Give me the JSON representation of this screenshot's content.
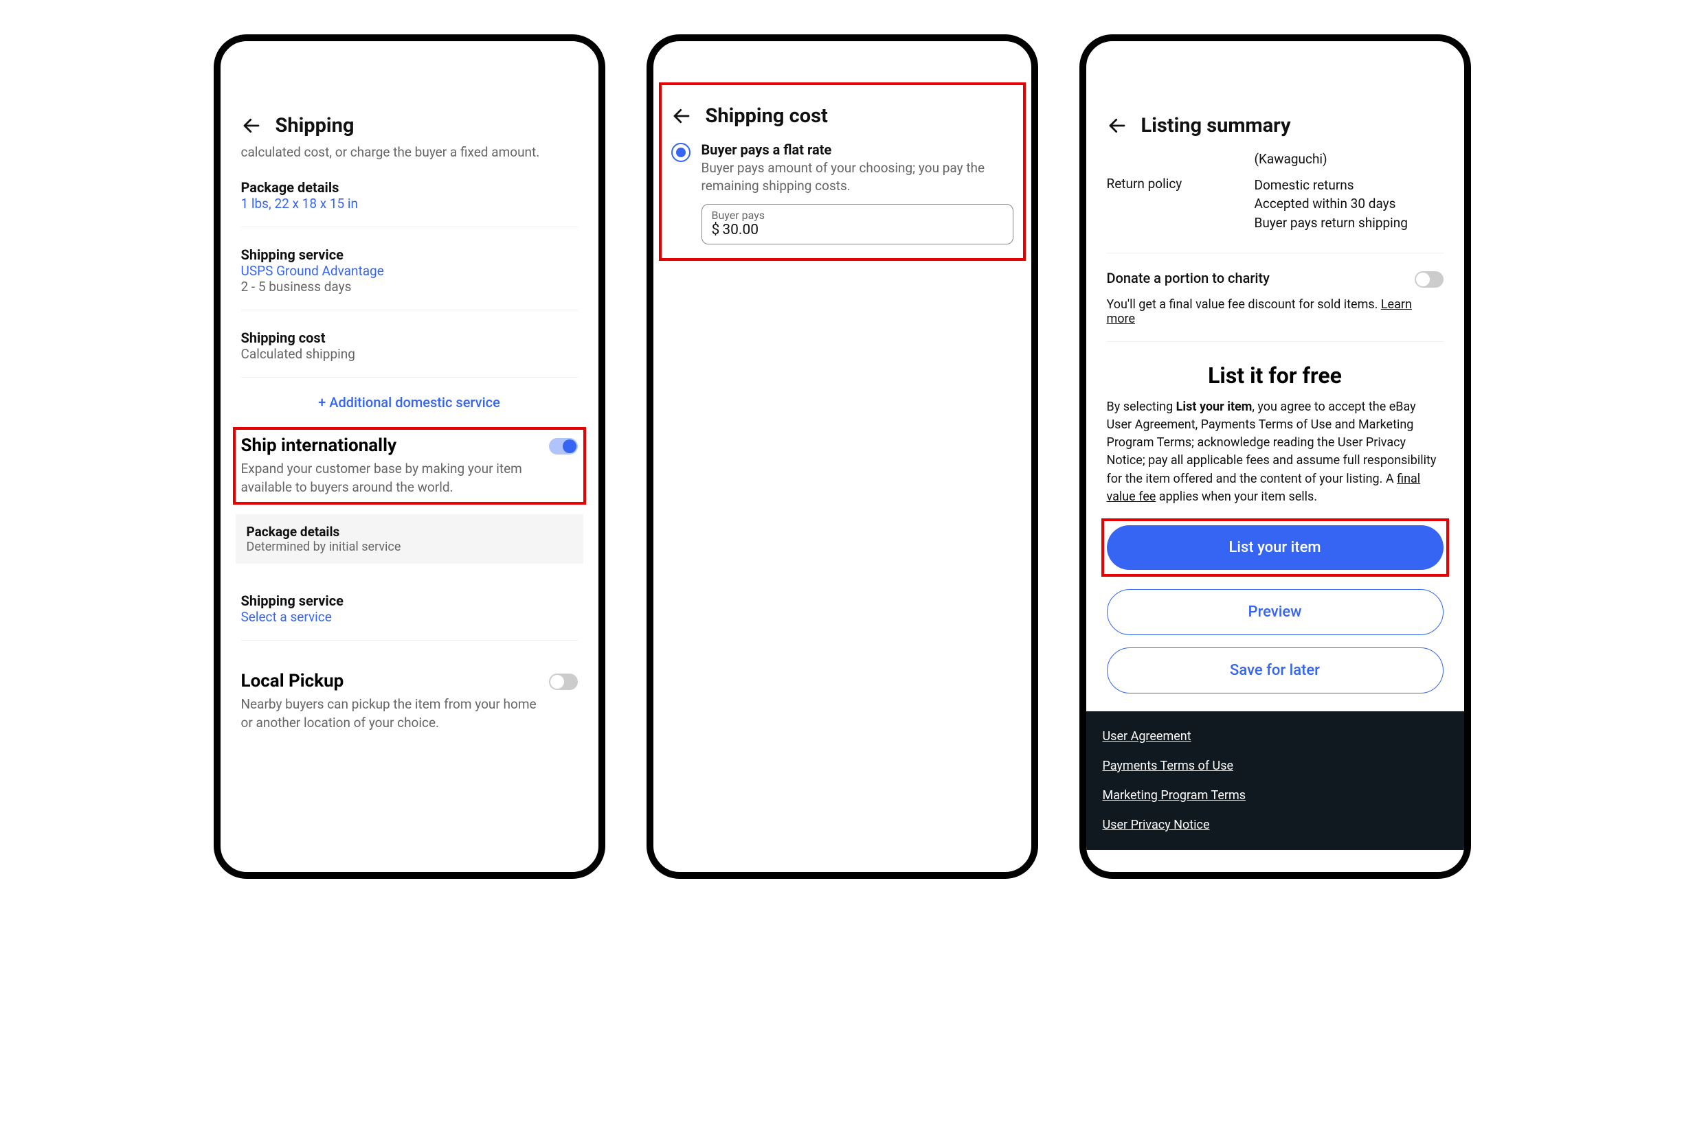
{
  "phone1": {
    "title": "Shipping",
    "subtitle": "calculated cost, or charge the buyer a fixed amount.",
    "pkg_label": "Package details",
    "pkg_value": "1 lbs, 22 x 18 x 15 in",
    "svc_label": "Shipping service",
    "svc_value": "USPS Ground Advantage",
    "svc_time": "2 - 5 business days",
    "cost_label": "Shipping cost",
    "cost_value": "Calculated shipping",
    "add_link": "+ Additional domestic service",
    "intl_title": "Ship internationally",
    "intl_desc": "Expand your customer base by making your item available to buyers around the world.",
    "intl_pkg_label": "Package details",
    "intl_pkg_value": "Determined by initial service",
    "intl_svc_label": "Shipping service",
    "intl_svc_value": "Select a service",
    "local_title": "Local Pickup",
    "local_desc": "Nearby buyers can pickup the item from your home or another location of your choice."
  },
  "phone2": {
    "title": "Shipping cost",
    "radio_title": "Buyer pays a flat rate",
    "radio_desc": "Buyer pays amount of your choosing; you pay the remaining shipping costs.",
    "input_label": "Buyer pays",
    "currency": "$",
    "input_value": "30.00"
  },
  "phone3": {
    "title": "Listing summary",
    "city": "(Kawaguchi)",
    "return_label": "Return policy",
    "return_v1": "Domestic returns",
    "return_v2": "Accepted within 30 days",
    "return_v3": "Buyer pays return shipping",
    "donate_title": "Donate a portion to charity",
    "donate_desc": "You'll get a final value fee discount for sold items. ",
    "learn_more": "Learn more",
    "list_free": "List it for free",
    "agree_pre": "By selecting ",
    "agree_bold": "List your item",
    "agree_mid": ", you agree to accept the eBay User Agreement, Payments Terms of Use and Marketing Program Terms; acknowledge reading the User Privacy Notice; pay all applicable fees and assume full responsibility for the item offered and the content of your listing. A ",
    "agree_fee": "final value fee",
    "agree_post": " applies when your item sells.",
    "btn_primary": "List your item",
    "btn_preview": "Preview",
    "btn_save": "Save for later",
    "footer": {
      "ua": "User Agreement",
      "pt": "Payments Terms of Use",
      "mp": "Marketing Program Terms",
      "up": "User Privacy Notice"
    }
  }
}
